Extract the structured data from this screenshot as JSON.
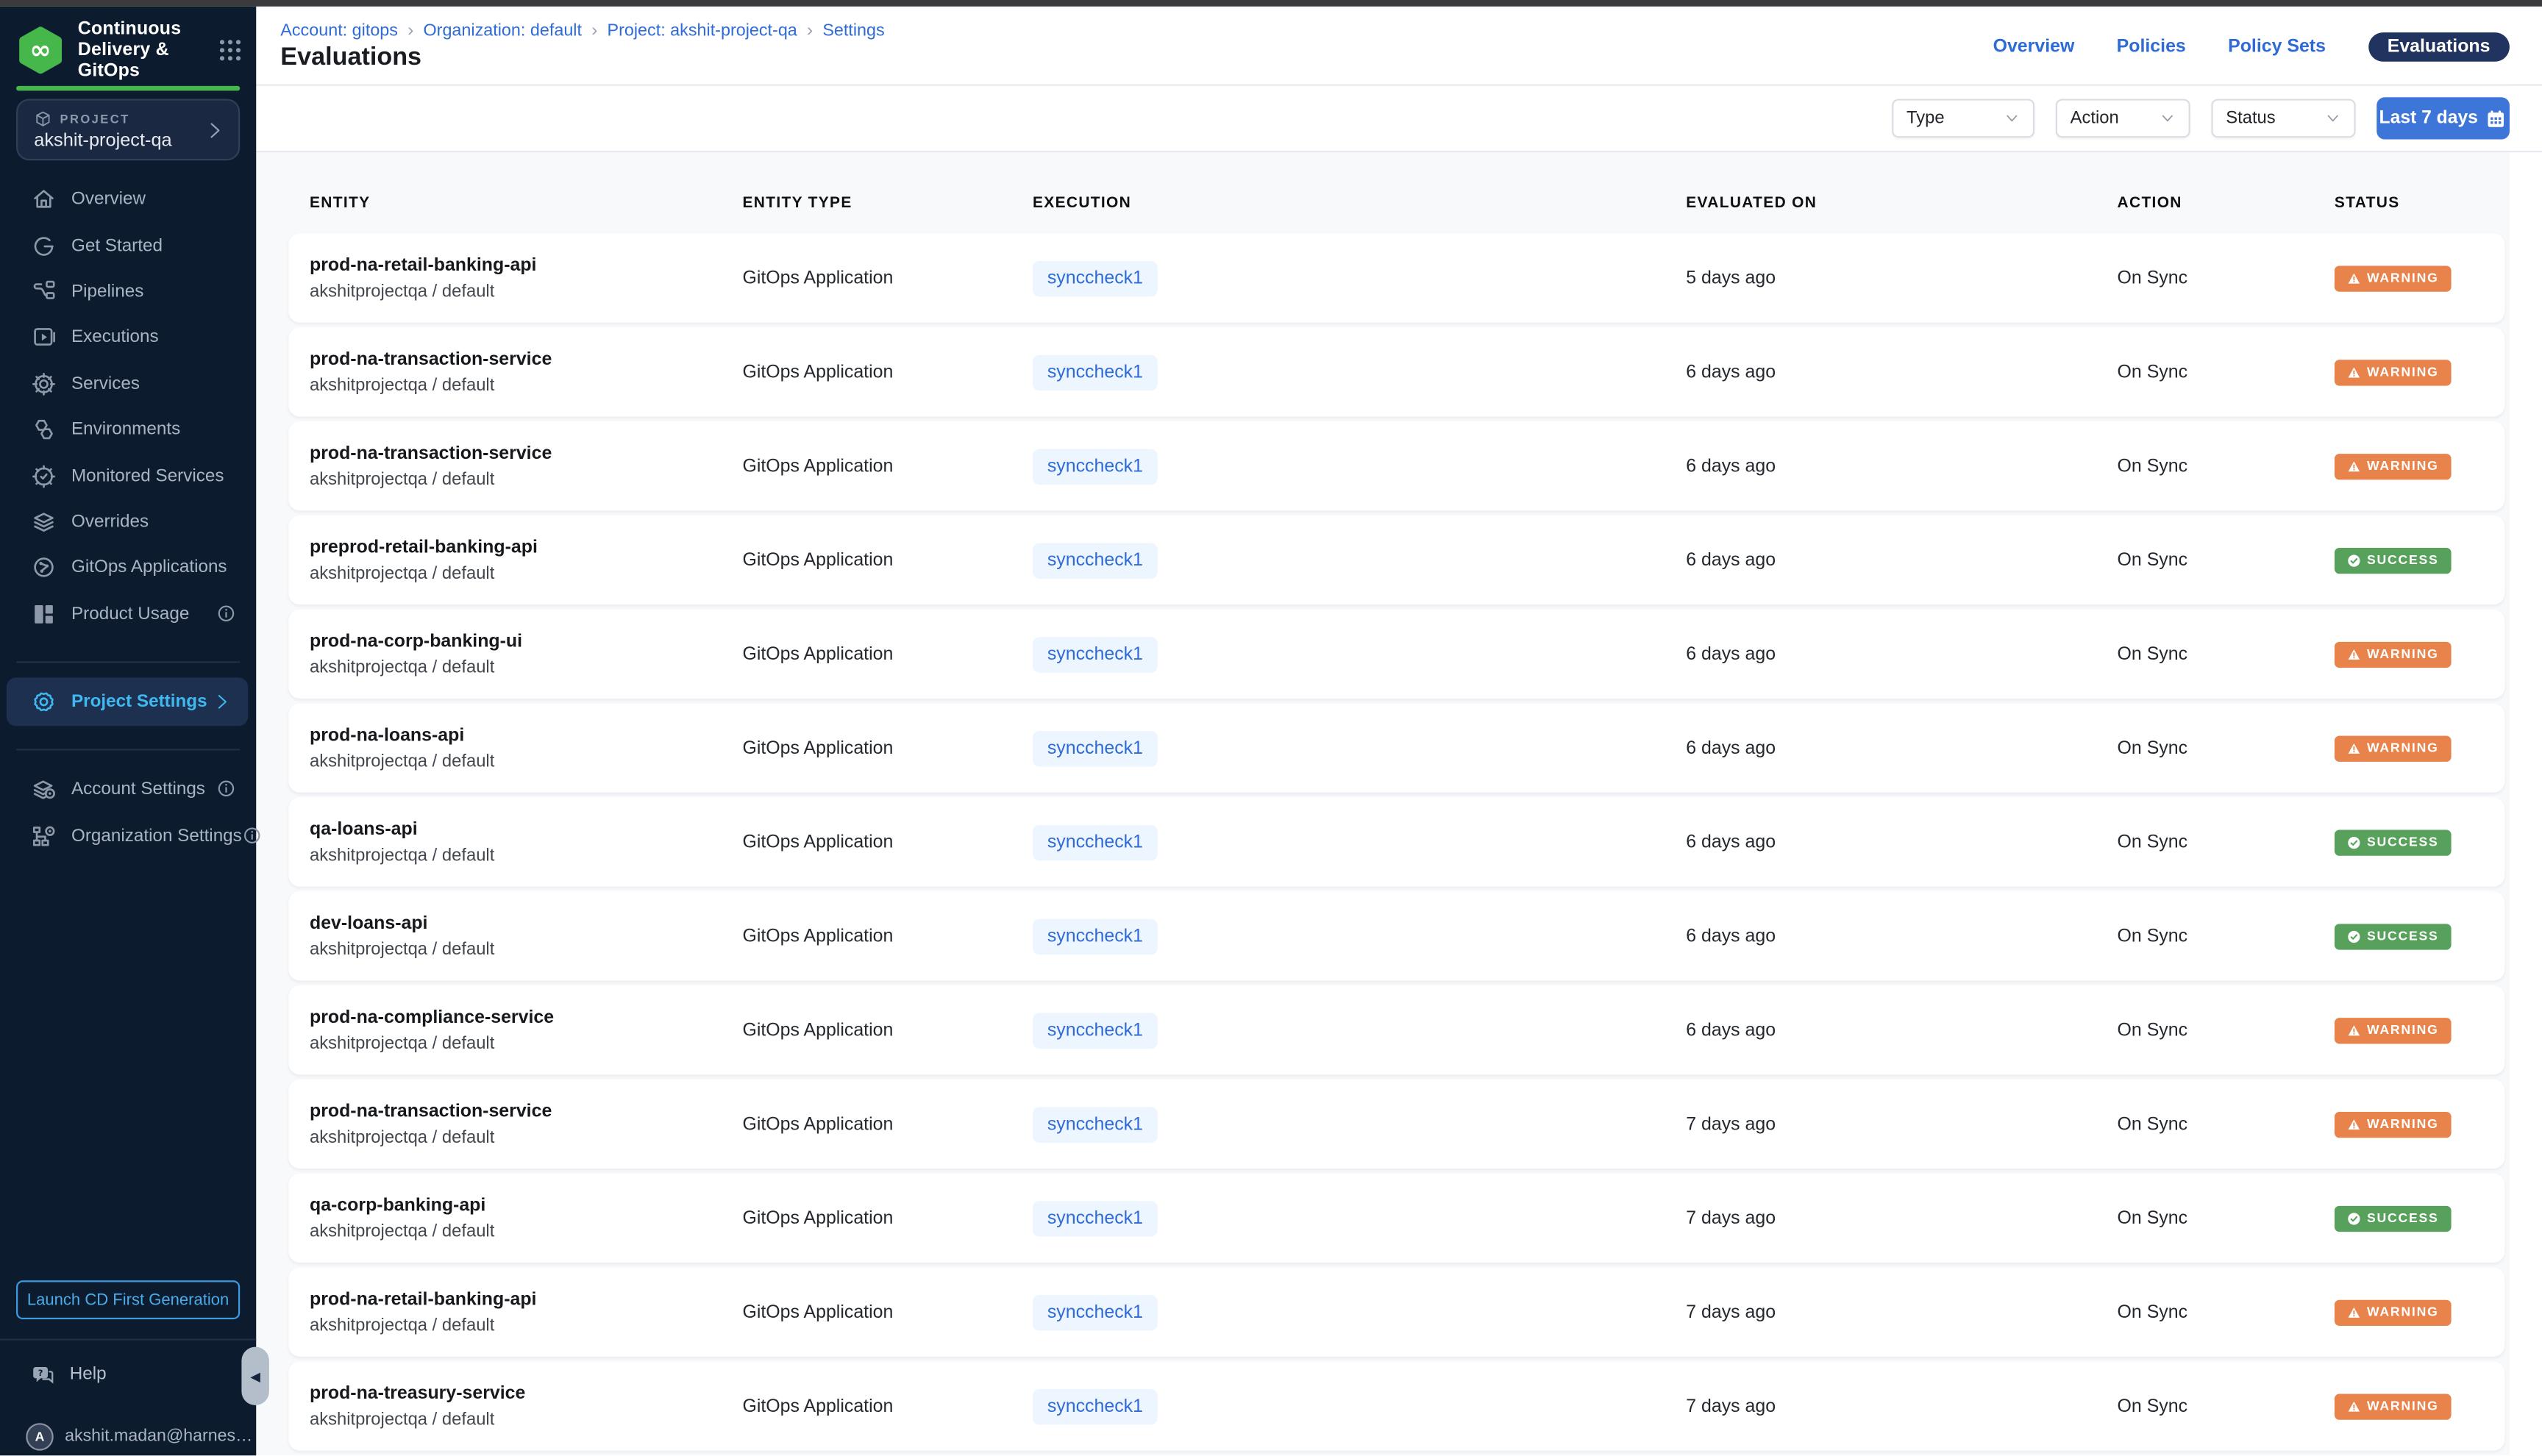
{
  "colors": {
    "sidebar_bg": "#0d1b2f",
    "sidebar_active": "#3fb8f0",
    "logo_green": "#46b74a",
    "link_blue": "#2e6bd6",
    "button_blue": "#3e75d8",
    "active_tab_bg": "#20345f",
    "warning": "#e8834b",
    "success": "#57a15c",
    "execution_pill_bg": "#edf6fe"
  },
  "sidebar": {
    "logo_icon": "harness-cd-logo",
    "modules_icon": "grid-9-dots-icon",
    "product_title_line1": "Continuous",
    "product_title_line2": "Delivery & GitOps",
    "project_selector": {
      "icon": "cube-icon",
      "label": "PROJECT",
      "name": "akshit-project-qa"
    },
    "nav_items": [
      {
        "label": "Overview",
        "icon": "home-icon"
      },
      {
        "label": "Get Started",
        "icon": "get-started-icon"
      },
      {
        "label": "Pipelines",
        "icon": "pipelines-icon"
      },
      {
        "label": "Executions",
        "icon": "executions-icon"
      },
      {
        "label": "Services",
        "icon": "services-icon"
      },
      {
        "label": "Environments",
        "icon": "environments-icon"
      },
      {
        "label": "Monitored Services",
        "icon": "monitored-services-icon"
      },
      {
        "label": "Overrides",
        "icon": "overrides-icon"
      },
      {
        "label": "GitOps Applications",
        "icon": "gitops-applications-icon"
      },
      {
        "label": "Product Usage",
        "icon": "product-usage-icon",
        "info": true
      }
    ],
    "selected_item": {
      "label": "Project Settings",
      "icon": "settings-gear-icon"
    },
    "admin_items": [
      {
        "label": "Account Settings",
        "icon": "account-settings-icon",
        "info": true
      },
      {
        "label": "Organization Settings",
        "icon": "organization-settings-icon",
        "info": true
      }
    ],
    "launch_button_label": "Launch CD First Generation",
    "help_label": "Help",
    "help_icon": "help-chat-icon",
    "user": {
      "avatar_initial": "A",
      "email": "akshit.madan@harnes…"
    }
  },
  "header": {
    "breadcrumbs": [
      "Account: gitops",
      "Organization: default",
      "Project: akshit-project-qa",
      "Settings"
    ],
    "page_title": "Evaluations",
    "nav_links": [
      "Overview",
      "Policies",
      "Policy Sets"
    ],
    "active_tab": "Evaluations"
  },
  "filters": {
    "type_label": "Type",
    "action_label": "Action",
    "status_label": "Status",
    "date_range_label": "Last 7 days",
    "date_icon": "calendar-icon"
  },
  "table": {
    "headers": [
      "ENTITY",
      "ENTITY TYPE",
      "EXECUTION",
      "EVALUATED ON",
      "ACTION",
      "STATUS"
    ],
    "rows": [
      {
        "entity": "prod-na-retail-banking-api",
        "scope": "akshitprojectqa / default",
        "entity_type": "GitOps Application",
        "execution": "synccheck1",
        "evaluated_on": "5 days ago",
        "action": "On Sync",
        "status": "WARNING"
      },
      {
        "entity": "prod-na-transaction-service",
        "scope": "akshitprojectqa / default",
        "entity_type": "GitOps Application",
        "execution": "synccheck1",
        "evaluated_on": "6 days ago",
        "action": "On Sync",
        "status": "WARNING"
      },
      {
        "entity": "prod-na-transaction-service",
        "scope": "akshitprojectqa / default",
        "entity_type": "GitOps Application",
        "execution": "synccheck1",
        "evaluated_on": "6 days ago",
        "action": "On Sync",
        "status": "WARNING"
      },
      {
        "entity": "preprod-retail-banking-api",
        "scope": "akshitprojectqa / default",
        "entity_type": "GitOps Application",
        "execution": "synccheck1",
        "evaluated_on": "6 days ago",
        "action": "On Sync",
        "status": "SUCCESS"
      },
      {
        "entity": "prod-na-corp-banking-ui",
        "scope": "akshitprojectqa / default",
        "entity_type": "GitOps Application",
        "execution": "synccheck1",
        "evaluated_on": "6 days ago",
        "action": "On Sync",
        "status": "WARNING"
      },
      {
        "entity": "prod-na-loans-api",
        "scope": "akshitprojectqa / default",
        "entity_type": "GitOps Application",
        "execution": "synccheck1",
        "evaluated_on": "6 days ago",
        "action": "On Sync",
        "status": "WARNING"
      },
      {
        "entity": "qa-loans-api",
        "scope": "akshitprojectqa / default",
        "entity_type": "GitOps Application",
        "execution": "synccheck1",
        "evaluated_on": "6 days ago",
        "action": "On Sync",
        "status": "SUCCESS"
      },
      {
        "entity": "dev-loans-api",
        "scope": "akshitprojectqa / default",
        "entity_type": "GitOps Application",
        "execution": "synccheck1",
        "evaluated_on": "6 days ago",
        "action": "On Sync",
        "status": "SUCCESS"
      },
      {
        "entity": "prod-na-compliance-service",
        "scope": "akshitprojectqa / default",
        "entity_type": "GitOps Application",
        "execution": "synccheck1",
        "evaluated_on": "6 days ago",
        "action": "On Sync",
        "status": "WARNING"
      },
      {
        "entity": "prod-na-transaction-service",
        "scope": "akshitprojectqa / default",
        "entity_type": "GitOps Application",
        "execution": "synccheck1",
        "evaluated_on": "7 days ago",
        "action": "On Sync",
        "status": "WARNING"
      },
      {
        "entity": "qa-corp-banking-api",
        "scope": "akshitprojectqa / default",
        "entity_type": "GitOps Application",
        "execution": "synccheck1",
        "evaluated_on": "7 days ago",
        "action": "On Sync",
        "status": "SUCCESS"
      },
      {
        "entity": "prod-na-retail-banking-api",
        "scope": "akshitprojectqa / default",
        "entity_type": "GitOps Application",
        "execution": "synccheck1",
        "evaluated_on": "7 days ago",
        "action": "On Sync",
        "status": "WARNING"
      },
      {
        "entity": "prod-na-treasury-service",
        "scope": "akshitprojectqa / default",
        "entity_type": "GitOps Application",
        "execution": "synccheck1",
        "evaluated_on": "7 days ago",
        "action": "On Sync",
        "status": "WARNING"
      }
    ]
  }
}
